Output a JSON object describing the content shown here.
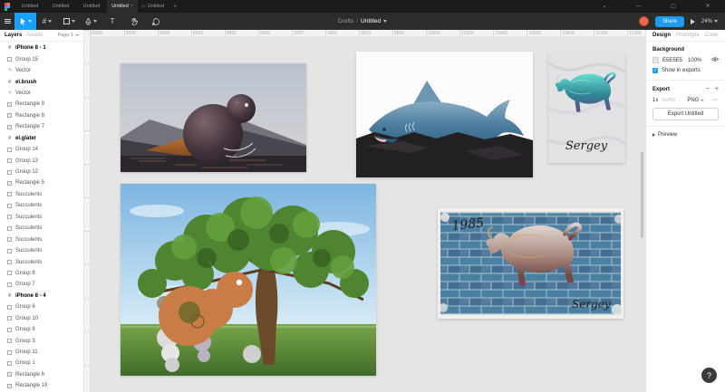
{
  "tabbar": {
    "tabs": [
      "Untitled",
      "Untitled",
      "Untitled",
      "Untitled",
      "Untitled"
    ],
    "active_tab_close": "×",
    "new_tab_label": "+",
    "window_controls": {
      "menu": "⌄",
      "minimize": "—",
      "maximize": "▢",
      "close": "✕"
    }
  },
  "toolbar": {
    "breadcrumb": {
      "root": "Drafts",
      "separator": "/",
      "doc": "Untitled"
    },
    "share_label": "Share",
    "zoom_level": "24%",
    "text_tool_glyph": "T",
    "frame_tool_glyph": "#"
  },
  "left": {
    "tab_layers": "Layers",
    "tab_assets": "Assets",
    "page_label": "Page 1",
    "layers": [
      {
        "label": "iPhone 8 - 1",
        "icon": "frame-icon",
        "style": "bold"
      },
      {
        "label": "Group 15",
        "icon": "group-icon",
        "style": ""
      },
      {
        "label": "Vector",
        "icon": "vector-icon",
        "style": ""
      },
      {
        "label": "el.brush",
        "icon": "frame-icon",
        "style": "bold"
      },
      {
        "label": "Vector",
        "icon": "vector-icon",
        "style": ""
      },
      {
        "label": "Rectangle 9",
        "icon": "rect-icon",
        "style": ""
      },
      {
        "label": "Rectangle 8",
        "icon": "rect-icon",
        "style": ""
      },
      {
        "label": "Rectangle 7",
        "icon": "rect-icon",
        "style": ""
      },
      {
        "label": "el.glater",
        "icon": "frame-icon",
        "style": "bold"
      },
      {
        "label": "Group 14",
        "icon": "group-icon",
        "style": ""
      },
      {
        "label": "Group 13",
        "icon": "group-icon",
        "style": ""
      },
      {
        "label": "Group 12",
        "icon": "group-icon",
        "style": ""
      },
      {
        "label": "Rectangle 5",
        "icon": "rect-icon",
        "style": ""
      },
      {
        "label": "Succulents",
        "icon": "group-icon",
        "style": ""
      },
      {
        "label": "Succulents",
        "icon": "group-icon",
        "style": ""
      },
      {
        "label": "Succulents",
        "icon": "group-icon",
        "style": ""
      },
      {
        "label": "Succulents",
        "icon": "group-icon",
        "style": ""
      },
      {
        "label": "Succulents",
        "icon": "group-icon",
        "style": ""
      },
      {
        "label": "Succulents",
        "icon": "group-icon",
        "style": ""
      },
      {
        "label": "Succulents",
        "icon": "group-icon",
        "style": ""
      },
      {
        "label": "Group 8",
        "icon": "group-icon",
        "style": ""
      },
      {
        "label": "Group 7",
        "icon": "group-icon",
        "style": ""
      },
      {
        "label": "iPhone 8 - 4",
        "icon": "frame-icon",
        "style": "bold"
      },
      {
        "label": "Group 6",
        "icon": "group-icon",
        "style": ""
      },
      {
        "label": "Group 10",
        "icon": "group-icon",
        "style": ""
      },
      {
        "label": "Group 9",
        "icon": "group-icon",
        "style": ""
      },
      {
        "label": "Group 3",
        "icon": "group-icon",
        "style": ""
      },
      {
        "label": "Group 11",
        "icon": "group-icon",
        "style": ""
      },
      {
        "label": "Group 1",
        "icon": "group-icon",
        "style": ""
      },
      {
        "label": "Rectangle 6",
        "icon": "rect-icon",
        "style": ""
      },
      {
        "label": "Rectangle 19",
        "icon": "rect-icon",
        "style": ""
      }
    ]
  },
  "right": {
    "tabs": {
      "design": "Design",
      "prototype": "Prototype",
      "code": "Code"
    },
    "background": {
      "title": "Background",
      "hex": "E5E5E5",
      "opacity": "100%",
      "checkbox_label": "Show in exports",
      "check_glyph": "✓"
    },
    "export": {
      "title": "Export",
      "minus": "−",
      "plus": "+",
      "scale": "1x",
      "suffix_placeholder": "Suffix",
      "format": "PNG",
      "more_glyph": "⋯",
      "button_label": "Export Untitled"
    },
    "preview_label": "Preview"
  },
  "canvas": {
    "ruler_h_labels": [
      "8000",
      "8200",
      "8400",
      "8600",
      "8800",
      "9000",
      "9200",
      "9400",
      "9600",
      "9800",
      "10000",
      "10200",
      "10400",
      "10600",
      "10800",
      "11000",
      "11200"
    ],
    "artboards": {
      "marble_bull": {
        "signature": "Sergey"
      },
      "brick_bull": {
        "year": "1985",
        "signature": "Sergey"
      }
    },
    "help_label": "?"
  },
  "colors": {
    "accent": "#18a0fb",
    "canvas_bg": "#e5e5e5",
    "background_swatch": "#e5e5e5",
    "avatar": "#e9694d"
  }
}
